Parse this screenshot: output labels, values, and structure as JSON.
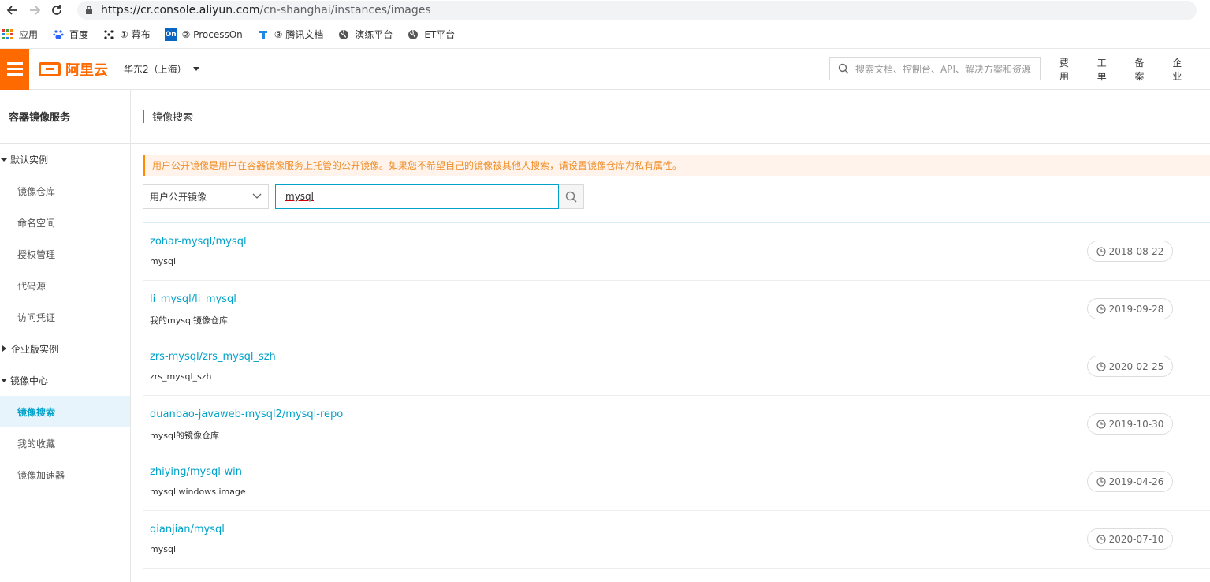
{
  "browser": {
    "url_host": "https://cr.console.aliyun.com",
    "url_path": "/cn-shanghai/instances/images",
    "bookmarks": [
      "应用",
      "百度",
      "① 幕布",
      "② ProcessOn",
      "③ 腾讯文档",
      "演练平台",
      "ET平台"
    ]
  },
  "topbar": {
    "logo_text": "阿里云",
    "region": "华东2（上海）",
    "search_placeholder": "搜索文档、控制台、API、解决方案和资源",
    "links": [
      "费用",
      "工单",
      "备案",
      "企业"
    ]
  },
  "sidebar": {
    "title": "容器镜像服务",
    "groups": [
      {
        "label": "默认实例",
        "expanded": true,
        "items": [
          "镜像仓库",
          "命名空间",
          "授权管理",
          "代码源",
          "访问凭证"
        ]
      },
      {
        "label": "企业版实例",
        "expanded": false,
        "items": []
      },
      {
        "label": "镜像中心",
        "expanded": true,
        "items": [
          "镜像搜索",
          "我的收藏",
          "镜像加速器"
        ]
      }
    ],
    "active_item": "镜像搜索"
  },
  "main": {
    "page_title": "镜像搜索",
    "notice": "用户公开镜像是用户在容器镜像服务上托管的公开镜像。如果您不希望自己的镜像被其他人搜索，请设置镜像仓库为私有属性。",
    "select_value": "用户公开镜像",
    "search_value": "mysql",
    "results": [
      {
        "name": "zohar-mysql/mysql",
        "desc": "mysql",
        "date": "2018-08-22"
      },
      {
        "name": "li_mysql/li_mysql",
        "desc": "我的mysql镜像仓库",
        "date": "2019-09-28"
      },
      {
        "name": "zrs-mysql/zrs_mysql_szh",
        "desc": "zrs_mysql_szh",
        "date": "2020-02-25"
      },
      {
        "name": "duanbao-javaweb-mysql2/mysql-repo",
        "desc": "mysql的镜像仓库",
        "date": "2019-10-30"
      },
      {
        "name": "zhiying/mysql-win",
        "desc": "mysql windows image",
        "date": "2019-04-26"
      },
      {
        "name": "qianjian/mysql",
        "desc": "mysql",
        "date": "2020-07-10"
      }
    ]
  },
  "colors": {
    "accent": "#00a2ca",
    "brand": "#ff6a00",
    "notice_text": "#f08f29"
  },
  "icons": [
    "back-arrow-icon",
    "forward-arrow-icon",
    "reload-icon",
    "lock-icon",
    "apps-grid-icon",
    "baidu-paw-icon",
    "search-icon",
    "clock-icon",
    "chevron-down-icon",
    "globe-icon"
  ]
}
